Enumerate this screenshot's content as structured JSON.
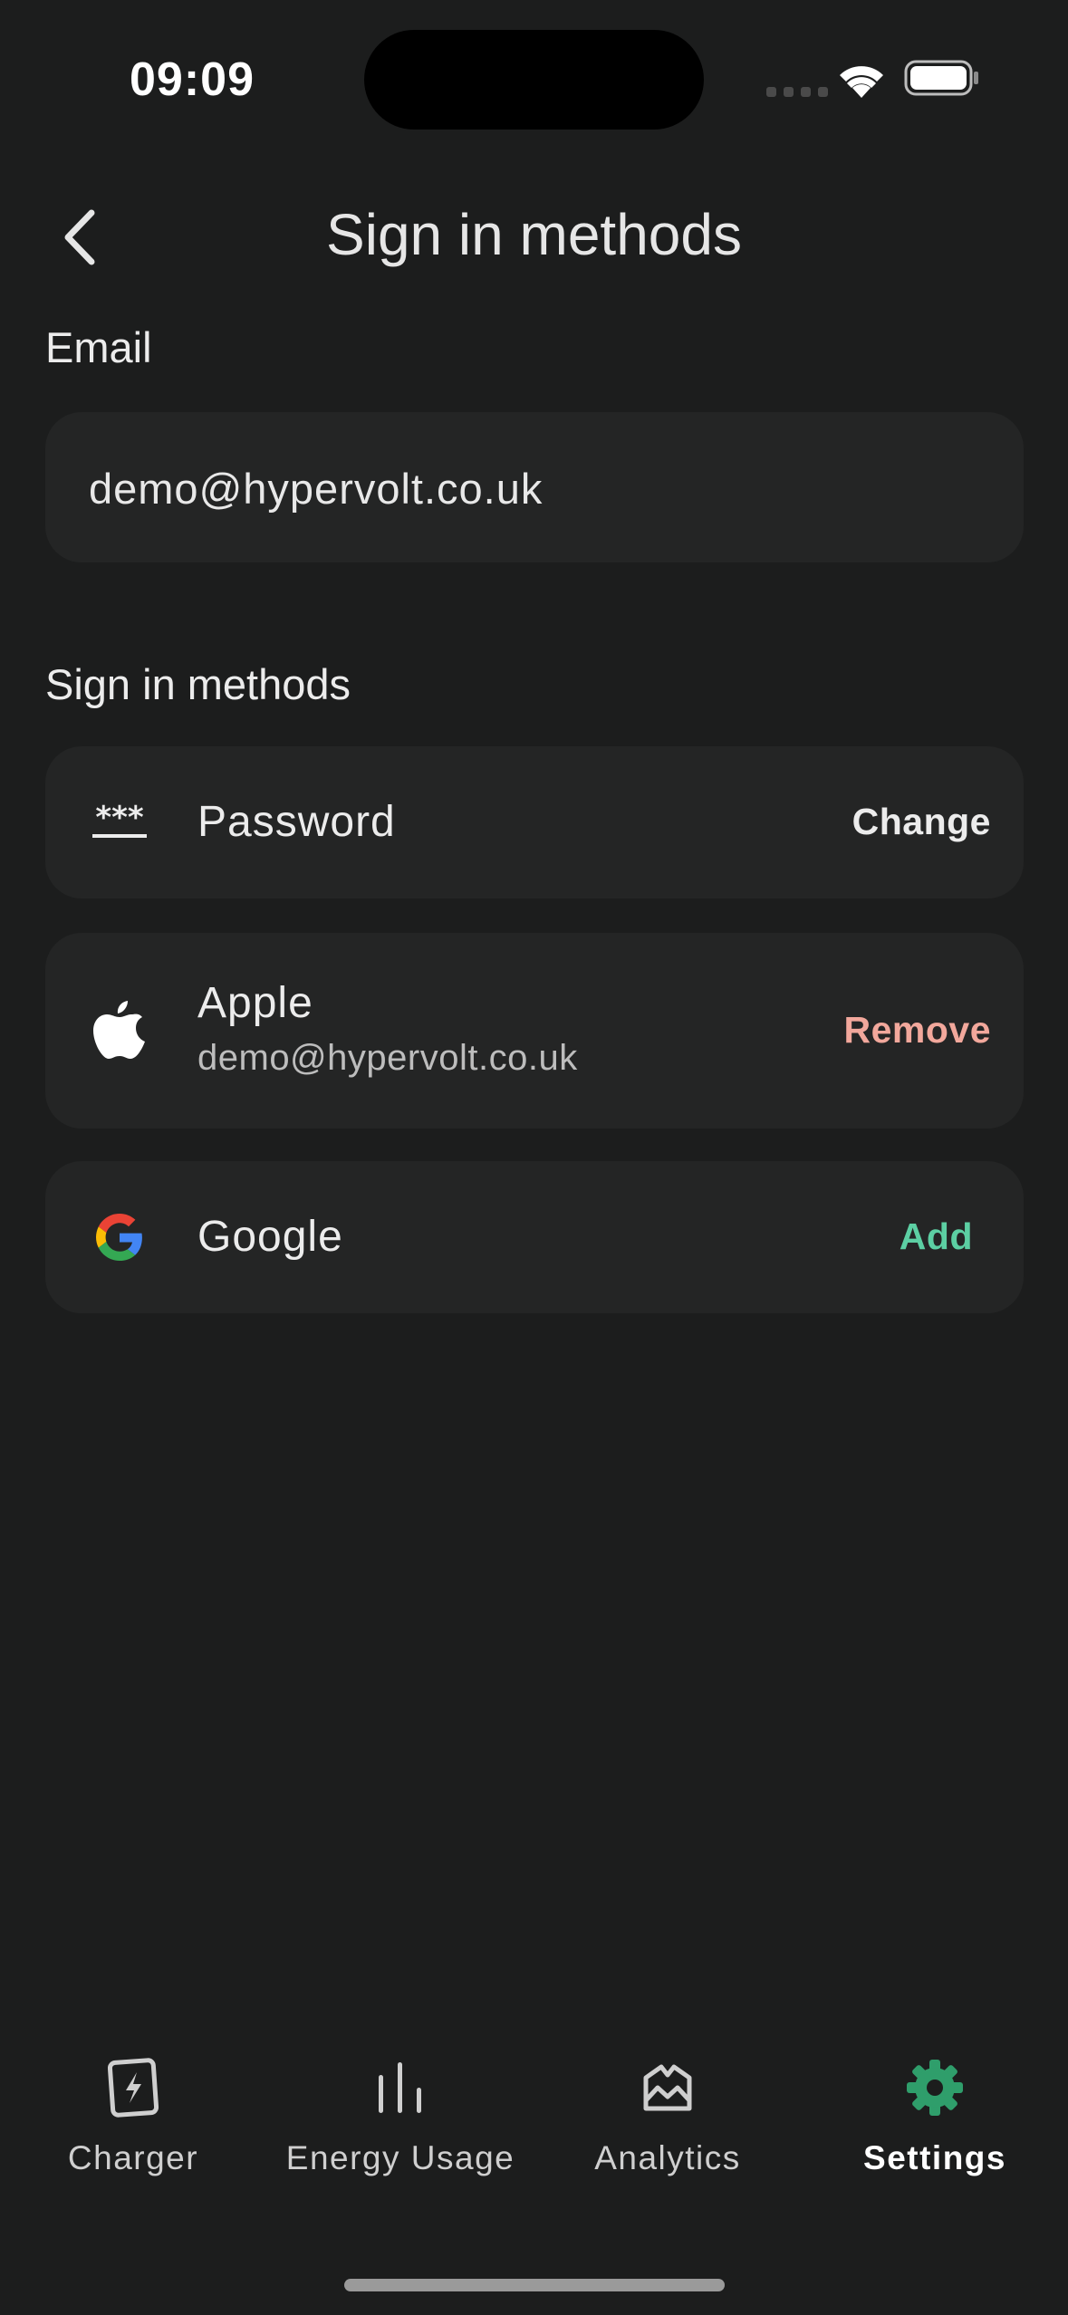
{
  "status_bar": {
    "time": "09:09"
  },
  "header": {
    "title": "Sign in methods"
  },
  "email_section": {
    "label": "Email",
    "value": "demo@hypervolt.co.uk"
  },
  "methods_section": {
    "label": "Sign in methods",
    "methods": [
      {
        "icon": "password-asterisks-icon",
        "name": "Password",
        "action": "Change"
      },
      {
        "icon": "apple-logo-icon",
        "name": "Apple",
        "detail": "demo@hypervolt.co.uk",
        "action": "Remove"
      },
      {
        "icon": "google-logo-icon",
        "name": "Google",
        "action": "Add"
      }
    ]
  },
  "bottom_nav": {
    "tabs": [
      {
        "icon": "charger-icon",
        "label": "Charger"
      },
      {
        "icon": "energy-usage-bars-icon",
        "label": "Energy Usage"
      },
      {
        "icon": "analytics-icon",
        "label": "Analytics"
      },
      {
        "icon": "settings-gear-icon",
        "label": "Settings",
        "active": true
      }
    ]
  },
  "colors": {
    "background": "#1c1d1d",
    "card": "#242525",
    "action_neutral": "#ececec",
    "action_remove": "#f2a89c",
    "action_add": "#5ccfa3",
    "accent_green": "#2f9e6b"
  }
}
